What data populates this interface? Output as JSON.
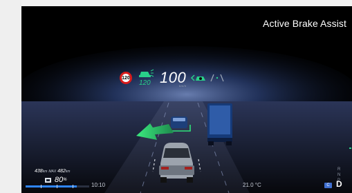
{
  "feature_title": "Active Brake Assist",
  "hud": {
    "speed_limit": "120",
    "acc_set_speed": "120",
    "current_speed": "100",
    "speed_unit": "km/h"
  },
  "status": {
    "range_value": "438",
    "range_unit": "km",
    "max_label": "MAX",
    "max_range_value": "482",
    "max_range_unit": "km",
    "battery_percent": "80",
    "battery_percent_unit": "%",
    "battery_level": 0.8,
    "time": "10:10",
    "outside_temp": "21.0 °C"
  },
  "drive": {
    "mode_badge": "C",
    "gear_options": [
      "R",
      "N",
      "P"
    ],
    "current_gear": "D"
  },
  "colors": {
    "accent_green": "#29d08a",
    "battery_blue": "#2f86ff",
    "speed_sign_red": "#d81b1b",
    "mode_badge_blue": "#3f6fd0"
  },
  "icons": {
    "acc": "car-acc-icon",
    "steering_assist": "steering-assist-icon",
    "lane_keeping": "lane-assist-icon",
    "battery": "battery-icon",
    "turn_arrow": "green-turn-arrow"
  }
}
